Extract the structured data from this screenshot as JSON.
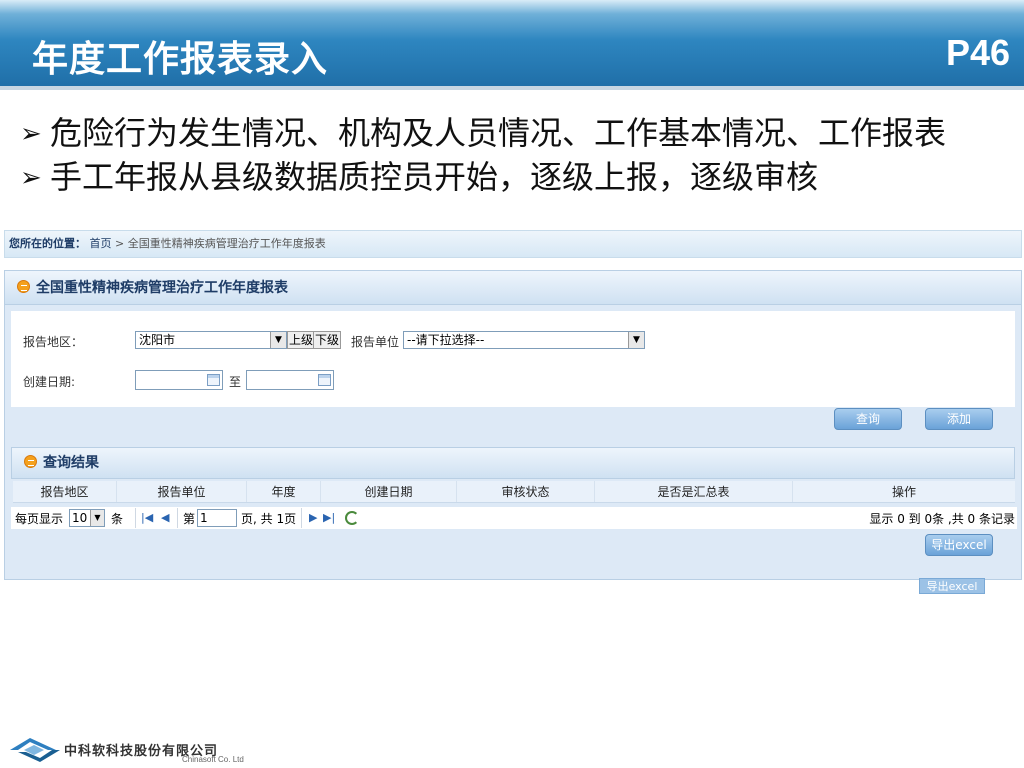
{
  "slide": {
    "title": "年度工作报表录入",
    "page": "P46",
    "bullets": [
      "危险行为发生情况、机构及人员情况、工作基本情况、工作报表",
      "手工年报从县级数据质控员开始，逐级上报，逐级审核"
    ]
  },
  "breadcrumb": {
    "label": "您所在的位置：",
    "home": "首页",
    "separator": ">",
    "current": "全国重性精神疾病管理治疗工作年度报表"
  },
  "panel": {
    "title": "全国重性精神疾病管理治疗工作年度报表"
  },
  "form": {
    "region_label": "报告地区：",
    "region_value": "沈阳市",
    "up_button": "上级",
    "down_button": "下级",
    "unit_label": "报告单位",
    "unit_value": "--请下拉选择--",
    "date_label": "创建日期:",
    "date_sep": "至",
    "query_button": "查询",
    "add_button": "添加"
  },
  "results": {
    "title": "查询结果",
    "columns": [
      "报告地区",
      "报告单位",
      "年度",
      "创建日期",
      "审核状态",
      "是否是汇总表",
      "操作"
    ]
  },
  "pager": {
    "per_page_label": "每页显示",
    "per_page_value": "10",
    "per_page_unit": "条",
    "page_prefix": "第",
    "page_value": "1",
    "page_suffix": "页, 共 1页",
    "info": "显示 0 到 0条 ,共 0 条记录"
  },
  "export_button": "导出excel",
  "footer": {
    "company_cn": "中科软科技股份有限公司",
    "company_en": "Chinasoft Co. Ltd"
  },
  "colors": {
    "header_blue": "#1f6ea7",
    "panel_bg": "#dde9f6",
    "button_blue": "#6aa2d8",
    "icon_orange": "#f4a01c"
  }
}
